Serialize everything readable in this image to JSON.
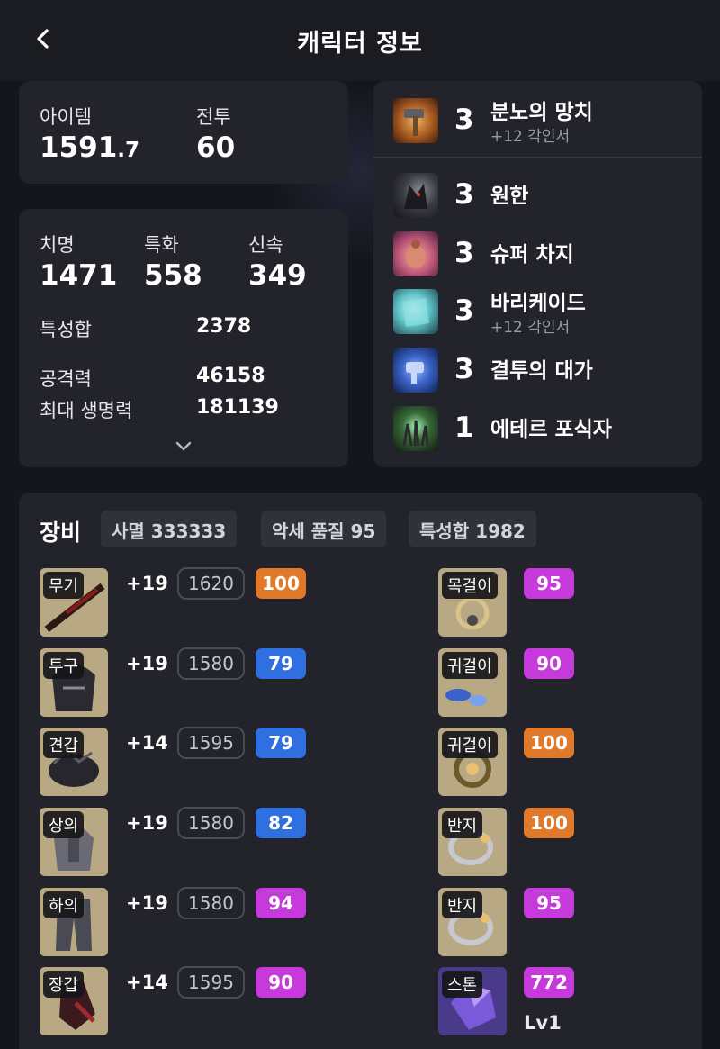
{
  "header": {
    "title": "캐릭터 정보"
  },
  "summary": {
    "item_label": "아이템",
    "item_value_main": "1591",
    "item_value_decimal": ".7",
    "combat_label": "전투",
    "combat_value": "60"
  },
  "stats": {
    "crit_label": "치명",
    "crit_value": "1471",
    "spec_label": "특화",
    "spec_value": "558",
    "swift_label": "신속",
    "swift_value": "349",
    "trait_sum_label": "특성합",
    "trait_sum_value": "2378",
    "attack_label": "공격력",
    "attack_value": "46158",
    "max_hp_label": "최대 생명력",
    "max_hp_value": "181139"
  },
  "engravings": [
    {
      "level": "3",
      "name": "분노의 망치",
      "sub": "+12 각인서",
      "icon": "hammer-icon",
      "color": "#c9792b"
    },
    {
      "level": "3",
      "name": "원한",
      "sub": "",
      "icon": "grudge-icon",
      "color": "#3a3b40"
    },
    {
      "level": "3",
      "name": "슈퍼 차지",
      "sub": "",
      "icon": "super-charge-icon",
      "color": "#c25a7a"
    },
    {
      "level": "3",
      "name": "바리케이드",
      "sub": "+12 각인서",
      "icon": "barricade-icon",
      "color": "#5fc4c8"
    },
    {
      "level": "3",
      "name": "결투의 대가",
      "sub": "",
      "icon": "duel-icon",
      "color": "#3a62c8"
    },
    {
      "level": "1",
      "name": "에테르 포식자",
      "sub": "",
      "icon": "ether-icon",
      "color": "#3a6a3a"
    }
  ],
  "equipment": {
    "title": "장비",
    "chips": [
      "사멸 333333",
      "악세 품질 95",
      "특성합 1982"
    ],
    "gear": [
      {
        "slot": "무기",
        "hone": "+19",
        "ilvl": "1620",
        "quality": "100",
        "quality_color": "#e07a2a",
        "icon": "weapon-icon"
      },
      {
        "slot": "투구",
        "hone": "+19",
        "ilvl": "1580",
        "quality": "79",
        "quality_color": "#2f6fe0",
        "icon": "helmet-icon"
      },
      {
        "slot": "견갑",
        "hone": "+14",
        "ilvl": "1595",
        "quality": "79",
        "quality_color": "#2f6fe0",
        "icon": "shoulder-icon"
      },
      {
        "slot": "상의",
        "hone": "+19",
        "ilvl": "1580",
        "quality": "82",
        "quality_color": "#2f6fe0",
        "icon": "chest-icon"
      },
      {
        "slot": "하의",
        "hone": "+19",
        "ilvl": "1580",
        "quality": "94",
        "quality_color": "#c63adb",
        "icon": "pants-icon"
      },
      {
        "slot": "장갑",
        "hone": "+14",
        "ilvl": "1595",
        "quality": "90",
        "quality_color": "#c63adb",
        "icon": "gloves-icon"
      }
    ],
    "accessories": [
      {
        "slot": "목걸이",
        "quality": "95",
        "quality_color": "#c63adb",
        "icon": "necklace-icon"
      },
      {
        "slot": "귀걸이",
        "quality": "90",
        "quality_color": "#c63adb",
        "icon": "earring-icon"
      },
      {
        "slot": "귀걸이",
        "quality": "100",
        "quality_color": "#e07a2a",
        "icon": "earring-icon"
      },
      {
        "slot": "반지",
        "quality": "100",
        "quality_color": "#e07a2a",
        "icon": "ring-icon"
      },
      {
        "slot": "반지",
        "quality": "95",
        "quality_color": "#c63adb",
        "icon": "ring-icon"
      },
      {
        "slot": "스톤",
        "quality": "772",
        "quality_color": "#c63adb",
        "level": "Lv1",
        "icon": "stone-icon"
      }
    ]
  }
}
